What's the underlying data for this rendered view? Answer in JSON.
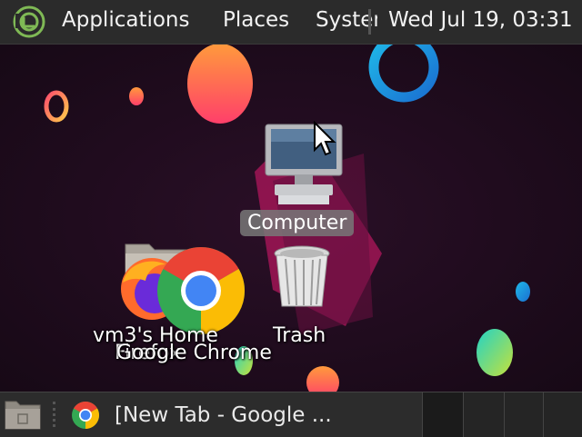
{
  "top_panel": {
    "menu_applications": "Applications",
    "menu_places": "Places",
    "menu_system": "System",
    "clock": "Wed Jul 19, 03:31",
    "logo_icon": "linux-mint-logo-icon"
  },
  "desktop": {
    "icons": {
      "computer": "Computer",
      "trash": "Trash",
      "home": "vm3's Home",
      "firefox": "Firefox",
      "chrome": "Google Chrome"
    }
  },
  "bottom_panel": {
    "launchers": [
      "show-desktop-icon",
      "chrome-icon"
    ],
    "task_title": "[New Tab - Google ...",
    "workspaces": 4
  },
  "colors": {
    "panel_bg": "#2b2b2b",
    "mint_green": "#7fb955",
    "wallpaper_bg": "#1e0d1d"
  }
}
